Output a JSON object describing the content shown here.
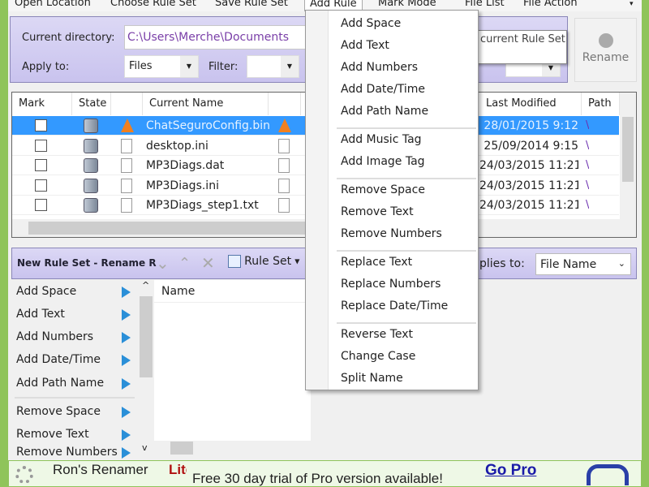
{
  "menu": {
    "items": [
      "Open Location",
      "Choose Rule Set",
      "Save Rule Set",
      "Add Rule",
      "Mark Mode",
      "File List",
      "File Action"
    ],
    "active": "Add Rule"
  },
  "location": {
    "current_directory_label": "Current directory:",
    "current_directory": "C:\\Users\\Merche\\Documents",
    "apply_to_label": "Apply to:",
    "apply_to_value": "Files",
    "filter_label": "Filter:",
    "filter_value": ""
  },
  "tooltip": "current Rule Set",
  "rename_button": "Rename",
  "file_table": {
    "columns": [
      "Mark",
      "State",
      "",
      "Current Name",
      "",
      "Last Modified",
      "Path"
    ],
    "rows": [
      {
        "name": "ChatSeguroConfig.bin",
        "icon": "vlc-icon",
        "modified": "28/01/2015 9:12",
        "path": "\\",
        "selected": true
      },
      {
        "name": "desktop.ini",
        "icon": "settings-file-icon",
        "modified": "25/09/2014 9:15",
        "path": "\\"
      },
      {
        "name": "MP3Diags.dat",
        "icon": "blank-file-icon",
        "modified": "24/03/2015 11:21",
        "path": "\\"
      },
      {
        "name": "MP3Diags.ini",
        "icon": "settings-file-icon",
        "modified": "24/03/2015 11:21",
        "path": "\\"
      },
      {
        "name": "MP3Diags_step1.txt",
        "icon": "text-file-icon",
        "modified": "24/03/2015 11:21",
        "path": "\\"
      }
    ]
  },
  "rule_toolbar": {
    "title": "New Rule Set - Rename R",
    "rule_set_label": "Rule Set",
    "applies_to_label": "plies to:",
    "applies_to_value": "File Name"
  },
  "rule_list": [
    "Add Space",
    "Add Text",
    "Add Numbers",
    "Add Date/Time",
    "Add Path Name",
    "Remove Space",
    "Remove Text",
    "Remove Numbers"
  ],
  "preview_table": {
    "header": "Name"
  },
  "add_rule_menu": {
    "groups": [
      [
        "Add Space",
        "Add Text",
        "Add Numbers",
        "Add Date/Time",
        "Add Path Name"
      ],
      [
        "Add Music Tag",
        "Add Image Tag"
      ],
      [
        "Remove Space",
        "Remove Text",
        "Remove Numbers"
      ],
      [
        "Replace Text",
        "Replace Numbers",
        "Replace Date/Time"
      ],
      [
        "Reverse Text",
        "Change Case",
        "Split Name"
      ]
    ]
  },
  "banner": {
    "app_name": "Ron's Renamer",
    "edition": "Lite",
    "message": "Free 30 day trial of Pro version available!",
    "link": "Go Pro"
  },
  "colors": {
    "accent": "#3399ff",
    "panel": "#d4cff2",
    "banner": "#eef8e6",
    "window_border": "#8fc45a",
    "edition": "#b01010",
    "link": "#1a1aa8"
  }
}
